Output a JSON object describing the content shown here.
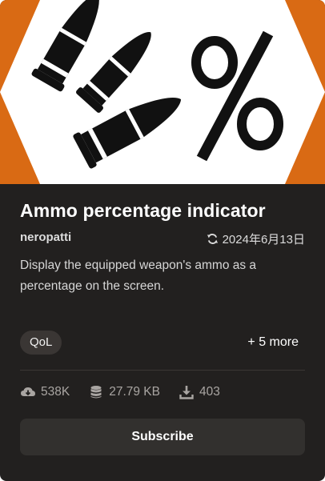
{
  "mod": {
    "title": "Ammo percentage indicator",
    "author": "neropatti",
    "updated": "2024年6月13日",
    "description": "Display the equipped weapon's ammo as a percentage on the screen.",
    "tags": [
      "QoL"
    ],
    "more_tags": "+ 5 more",
    "stats": {
      "endorsements": "538K",
      "size": "27.79 KB",
      "downloads": "403"
    },
    "subscribe_label": "Subscribe"
  },
  "colors": {
    "thumbnail_orange": "#d96a14",
    "thumbnail_white": "#ffffff",
    "card_background": "#22201f"
  },
  "icons": {
    "updated": "refresh-icon",
    "endorsements": "cloud-download-icon",
    "size": "database-icon",
    "downloads": "download-icon"
  }
}
